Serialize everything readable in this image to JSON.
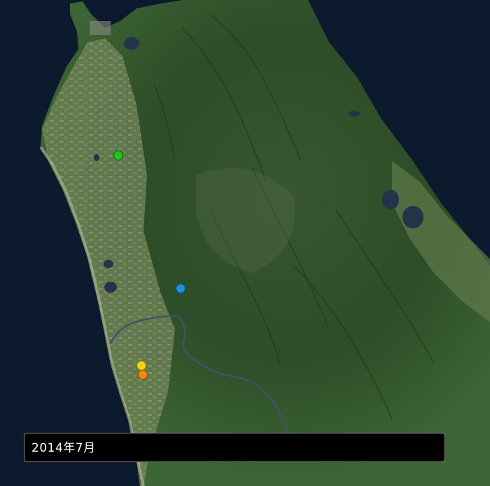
{
  "map": {
    "markers": [
      {
        "id": "green",
        "color": "#22c41c"
      },
      {
        "id": "blue",
        "color": "#1f8fe6"
      },
      {
        "id": "yellow",
        "color": "#f2d31a"
      },
      {
        "id": "orange",
        "color": "#f08a0c"
      }
    ],
    "palette": {
      "sea": "#0b1a2c",
      "land_dark": "#2a4a26",
      "land_mid": "#3f6a35",
      "farmland": "#7d8c62",
      "lake": "#24334a",
      "river": "#3e5466"
    }
  },
  "timeline": {
    "date_label": "2014年7月"
  }
}
